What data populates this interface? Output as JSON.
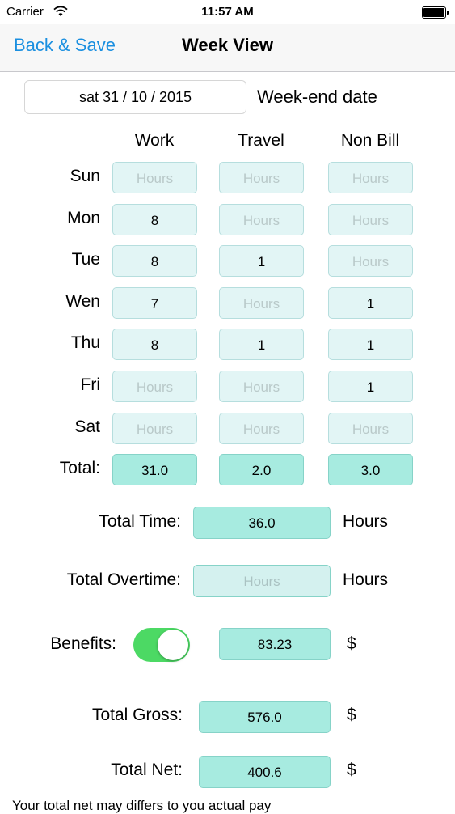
{
  "status_bar": {
    "carrier": "Carrier",
    "time": "11:57 AM"
  },
  "nav": {
    "back_label": "Back & Save",
    "title": "Week View"
  },
  "week_end": {
    "value": "sat 31 / 10 / 2015",
    "label": "Week-end date"
  },
  "columns": [
    "Work",
    "Travel",
    "Non Bill"
  ],
  "placeholder": "Hours",
  "rows": [
    {
      "day": "Sun",
      "work": "",
      "travel": "",
      "nonbill": ""
    },
    {
      "day": "Mon",
      "work": "8",
      "travel": "",
      "nonbill": ""
    },
    {
      "day": "Tue",
      "work": "8",
      "travel": "1",
      "nonbill": ""
    },
    {
      "day": "Wen",
      "work": "7",
      "travel": "",
      "nonbill": "1"
    },
    {
      "day": "Thu",
      "work": "8",
      "travel": "1",
      "nonbill": "1"
    },
    {
      "day": "Fri",
      "work": "",
      "travel": "",
      "nonbill": "1"
    },
    {
      "day": "Sat",
      "work": "",
      "travel": "",
      "nonbill": ""
    }
  ],
  "totals": {
    "label": "Total:",
    "work": "31.0",
    "travel": "2.0",
    "nonbill": "3.0"
  },
  "total_time": {
    "label": "Total Time:",
    "value": "36.0",
    "unit": "Hours"
  },
  "total_overtime": {
    "label": "Total Overtime:",
    "value": "",
    "placeholder": "Hours",
    "unit": "Hours"
  },
  "benefits": {
    "label": "Benefits:",
    "enabled": true,
    "value": "83.23",
    "unit": "$"
  },
  "total_gross": {
    "label": "Total Gross:",
    "value": "576.0",
    "unit": "$"
  },
  "total_net": {
    "label": "Total Net:",
    "value": "400.6",
    "unit": "$"
  },
  "footnote": "Your total net  may differs to you actual pay",
  "colors": {
    "accent": "#1a8fe0",
    "field": "#e2f5f5",
    "total_field": "#a7ebe0",
    "toggle_on": "#4cd964"
  }
}
